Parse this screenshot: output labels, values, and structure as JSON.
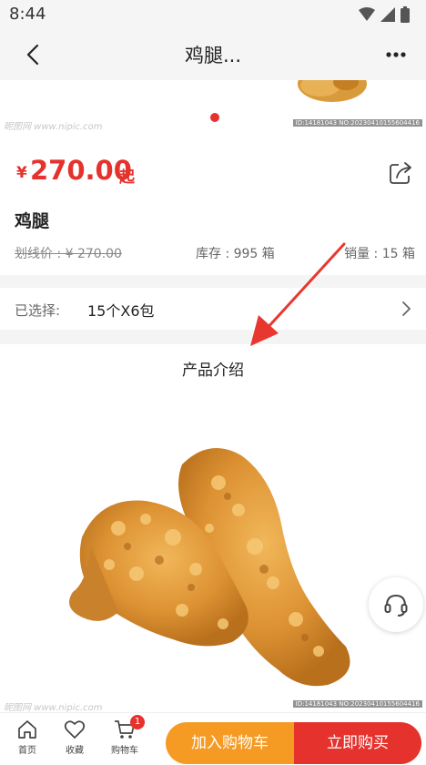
{
  "status_bar": {
    "time": "8:44",
    "icons": [
      "wifi-icon",
      "signal-icon",
      "battery-icon"
    ]
  },
  "header": {
    "title": "鸡腿...",
    "back_icon": "chevron-left-icon",
    "more_icon": "more-dots-icon"
  },
  "carousel": {
    "watermark_left": "昵图网 www.nipic.com",
    "watermark_right": "ID:14181043 NO:20230410155604416",
    "active_dot_color": "#e5322d"
  },
  "product": {
    "currency_symbol": "¥",
    "price": "270.00",
    "price_suffix": "起",
    "name": "鸡腿",
    "original_price": "划线价 : ¥ 270.00",
    "stock": "库存 : 995 箱",
    "sales": "销量 : 15 箱",
    "share_icon": "share-icon"
  },
  "selection": {
    "label": "已选择:",
    "value": "15个X6包"
  },
  "intro": {
    "title": "产品介绍",
    "image_watermark_left": "昵图网 www.nipic.com",
    "image_watermark_right": "ID:14181043 NO:20230410155604416"
  },
  "floating": {
    "customer_service_icon": "headset-icon"
  },
  "bottom_bar": {
    "home_label": "首页",
    "favorite_label": "收藏",
    "cart_label": "购物车",
    "cart_badge": "1",
    "add_to_cart": "加入购物车",
    "buy_now": "立即购买"
  },
  "colors": {
    "accent_red": "#e5322d",
    "accent_orange": "#f59a23"
  }
}
